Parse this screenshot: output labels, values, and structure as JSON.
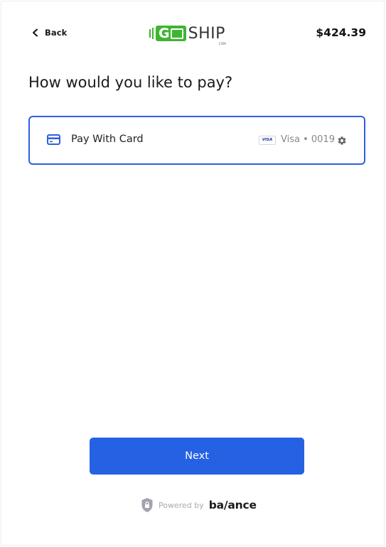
{
  "header": {
    "back_label": "Back",
    "logo": {
      "go_text": "GO",
      "ship_text": "SHIP",
      "com_text": ".COM"
    },
    "total": "$424.39"
  },
  "title": "How would you like to pay?",
  "payment_option": {
    "label": "Pay With Card",
    "card_brand_badge": "VISA",
    "card_summary": "Visa • 0019",
    "icons": {
      "card": "credit-card-icon",
      "settings": "gear-icon"
    }
  },
  "next_button": {
    "label": "Next"
  },
  "footer": {
    "powered_by": "Powered by",
    "brand": "ba/ance"
  },
  "colors": {
    "accent": "#2561e3",
    "selected_border": "#2f5fe0",
    "logo_green": "#3fb532"
  }
}
